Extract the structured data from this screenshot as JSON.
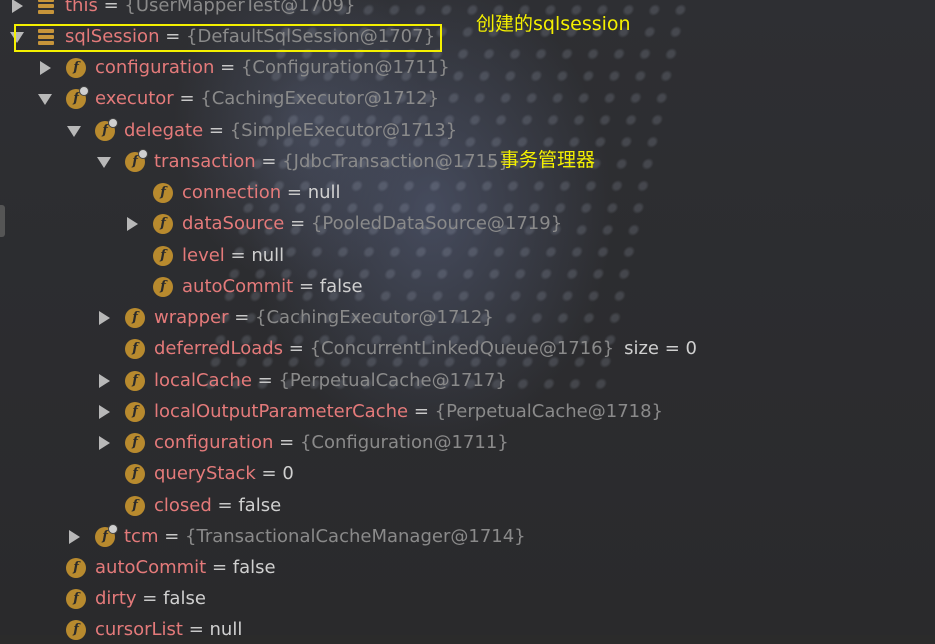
{
  "annotations": {
    "sqlsession_note": "创建的sqlsession",
    "transaction_note": "事务管理器"
  },
  "colors": {
    "field_name": "#e47a7a",
    "ref_value": "#8a8a8a",
    "highlight": "#f4f000",
    "field_icon": "#b88a2e"
  },
  "tree": [
    {
      "arrow": "right",
      "icon": "variable-icon",
      "name": "this",
      "eq": " = ",
      "value": "{UserMapperTest@1709}",
      "ref": true
    },
    {
      "arrow": "down",
      "icon": "variable-icon",
      "name": "sqlSession",
      "eq": " = ",
      "value": "{DefaultSqlSession@1707}",
      "ref": true
    },
    {
      "arrow": "right",
      "icon": "field-icon",
      "name": "configuration",
      "eq": " = ",
      "value": "{Configuration@1711}",
      "ref": true
    },
    {
      "arrow": "down",
      "icon": "field-icon",
      "name": "executor",
      "eq": " = ",
      "value": "{CachingExecutor@1712}",
      "ref": true
    },
    {
      "arrow": "down",
      "icon": "field-icon",
      "name": "delegate",
      "eq": " = ",
      "value": "{SimpleExecutor@1713}",
      "ref": true
    },
    {
      "arrow": "down",
      "icon": "field-icon",
      "name": "transaction",
      "eq": " = ",
      "value": "{JdbcTransaction@1715}",
      "ref": true
    },
    {
      "arrow": "none",
      "icon": "field-icon",
      "name": "connection",
      "eq": " = ",
      "value": "null",
      "ref": false
    },
    {
      "arrow": "right",
      "icon": "field-icon",
      "name": "dataSource",
      "eq": " = ",
      "value": "{PooledDataSource@1719}",
      "ref": true
    },
    {
      "arrow": "none",
      "icon": "field-icon",
      "name": "level",
      "eq": " = ",
      "value": "null",
      "ref": false
    },
    {
      "arrow": "none",
      "icon": "field-icon",
      "name": "autoCommit",
      "eq": " = ",
      "value": "false",
      "ref": false
    },
    {
      "arrow": "right",
      "icon": "field-icon",
      "name": "wrapper",
      "eq": " = ",
      "value": "{CachingExecutor@1712}",
      "ref": true
    },
    {
      "arrow": "none",
      "icon": "field-icon",
      "name": "deferredLoads",
      "eq": " = ",
      "value": "{ConcurrentLinkedQueue@1716}",
      "ref": true,
      "extra": "size = 0"
    },
    {
      "arrow": "right",
      "icon": "field-icon",
      "name": "localCache",
      "eq": " = ",
      "value": "{PerpetualCache@1717}",
      "ref": true
    },
    {
      "arrow": "right",
      "icon": "field-icon",
      "name": "localOutputParameterCache",
      "eq": " = ",
      "value": "{PerpetualCache@1718}",
      "ref": true
    },
    {
      "arrow": "right",
      "icon": "field-icon",
      "name": "configuration",
      "eq": " = ",
      "value": "{Configuration@1711}",
      "ref": true
    },
    {
      "arrow": "none",
      "icon": "field-icon",
      "name": "queryStack",
      "eq": " = ",
      "value": "0",
      "ref": false
    },
    {
      "arrow": "none",
      "icon": "field-icon",
      "name": "closed",
      "eq": " = ",
      "value": "false",
      "ref": false
    },
    {
      "arrow": "right",
      "icon": "field-icon",
      "name": "tcm",
      "eq": " = ",
      "value": "{TransactionalCacheManager@1714}",
      "ref": true
    },
    {
      "arrow": "none",
      "icon": "field-icon",
      "name": "autoCommit",
      "eq": " = ",
      "value": "false",
      "ref": false
    },
    {
      "arrow": "none",
      "icon": "field-icon",
      "name": "dirty",
      "eq": " = ",
      "value": "false",
      "ref": false
    },
    {
      "arrow": "none",
      "icon": "field-icon",
      "name": "cursorList",
      "eq": " = ",
      "value": "null",
      "ref": false
    }
  ]
}
